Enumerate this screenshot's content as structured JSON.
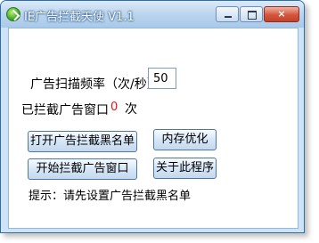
{
  "window": {
    "title": "IE广告拦截天使 V1.1",
    "min_glyph": "",
    "max_glyph": "",
    "close_glyph": "×"
  },
  "settings": {
    "frequency_label": "广告扫描频率（次/秒）",
    "frequency_value": "50",
    "blocked_label": "已拦截广告窗口",
    "blocked_count": "0",
    "blocked_unit": "次"
  },
  "buttons": {
    "open_blacklist": "打开广告拦截黑名单",
    "memory_optimize": "内存优化",
    "start_block": "开始拦截广告窗口",
    "about": "关于此程序"
  },
  "status": {
    "hint": "提示：请先设置广告拦截黑名单"
  },
  "colors": {
    "accent": "#2f6ea8",
    "count_color": "#ee1111"
  }
}
